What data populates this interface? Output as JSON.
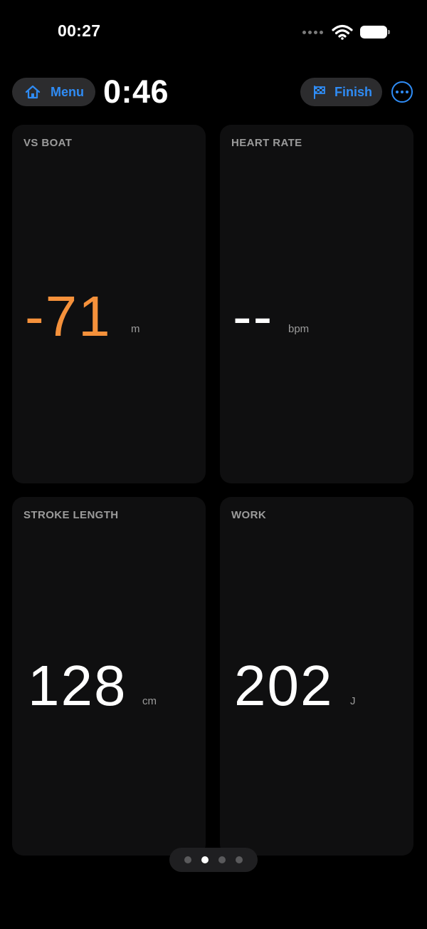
{
  "status_bar": {
    "time": "00:27"
  },
  "header": {
    "menu_label": "Menu",
    "timer": "0:46",
    "finish_label": "Finish"
  },
  "metrics": [
    {
      "label": "VS BOAT",
      "value": "-71",
      "unit": "m",
      "color": "#f5913b"
    },
    {
      "label": "HEART RATE",
      "value": "--",
      "unit": "bpm"
    },
    {
      "label": "STROKE LENGTH",
      "value": "128",
      "unit": "cm"
    },
    {
      "label": "WORK",
      "value": "202",
      "unit": "J"
    }
  ],
  "page_indicator": {
    "pages": 4,
    "current": 2
  },
  "colors": {
    "accent": "#2f8cf5",
    "warning": "#f5913b",
    "background": "#000000",
    "card": "#0f0f10"
  },
  "icons": {
    "menu": "home-icon",
    "finish": "checkered-flag-icon",
    "more": "more-icon"
  }
}
